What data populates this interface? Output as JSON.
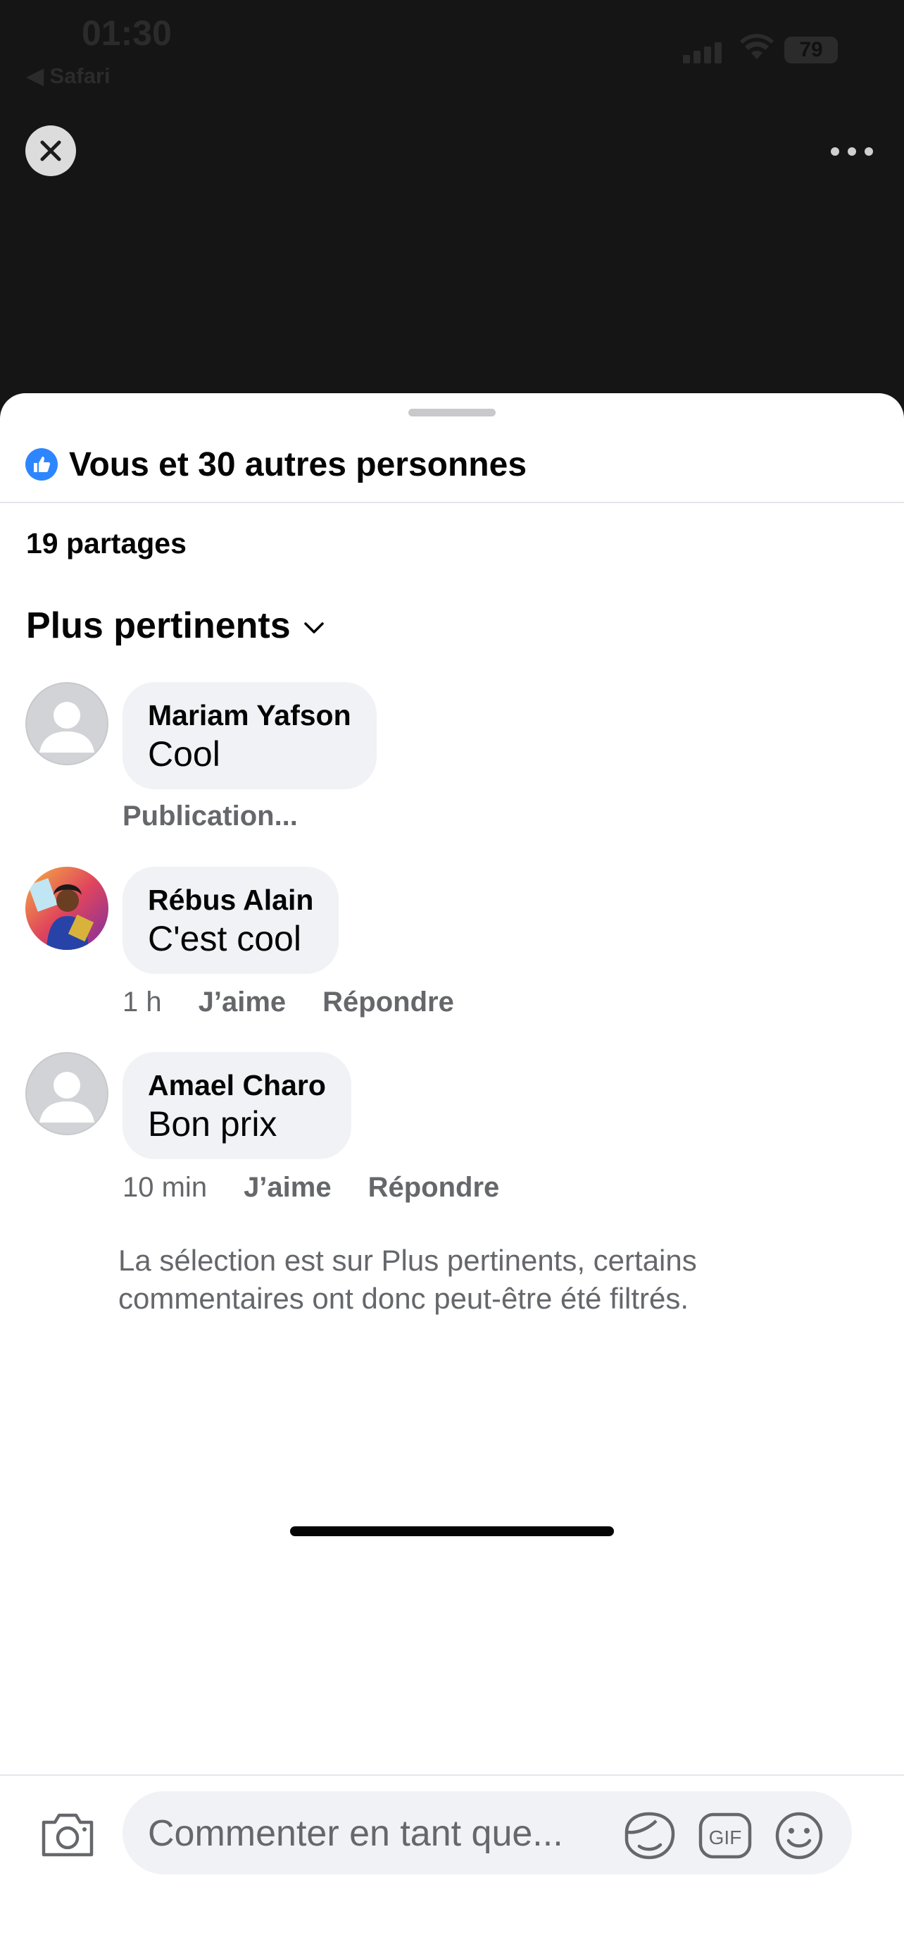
{
  "status_bar": {
    "time": "01:30",
    "back_app": "◀ Safari",
    "battery": "79"
  },
  "header": {
    "close_icon": "close-icon",
    "more_icon": "more-icon"
  },
  "sheet": {
    "reactions_text": "Vous et 30 autres personnes",
    "shares_text": "19 partages",
    "sort_label": "Plus pertinents"
  },
  "comments": [
    {
      "name": "Mariam Yafson",
      "text": "Cool",
      "status": "Publication..."
    },
    {
      "name": "Rébus Alain",
      "text": "C'est cool",
      "time": "1 h",
      "like_label": "J’aime",
      "reply_label": "Répondre"
    },
    {
      "name": "Amael Charo",
      "text": "Bon prix",
      "time": "10 min",
      "like_label": "J’aime",
      "reply_label": "Répondre"
    }
  ],
  "notice": "La sélection est sur Plus pertinents, certains commentaires ont donc peut-être été filtrés.",
  "composer": {
    "placeholder": "Commenter en tant que..."
  },
  "colors": {
    "accent": "#2d86ff",
    "bubble": "#f0f2f5",
    "secondary_text": "#65676b"
  }
}
